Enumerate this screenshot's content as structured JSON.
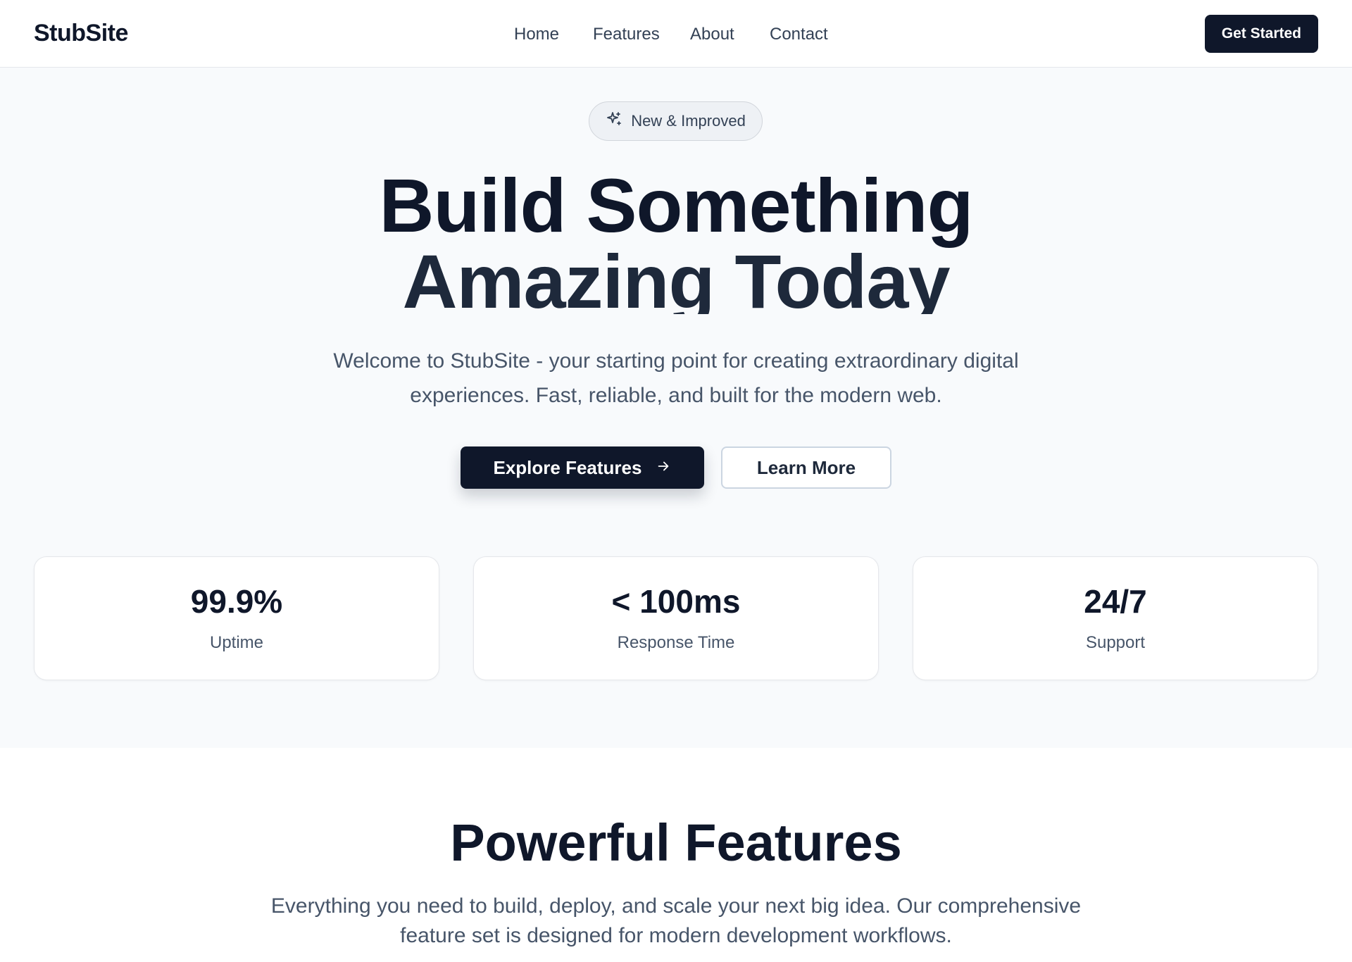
{
  "nav": {
    "brand": "StubSite",
    "links": [
      "Home",
      "Features",
      "About",
      "Contact"
    ],
    "cta": "Get Started"
  },
  "hero": {
    "badge": "New & Improved",
    "headline_line1": "Build Something",
    "headline_line2": "Amazing Today",
    "subtitle": "Welcome to StubSite - your starting point for creating extraordinary digital experiences. Fast, reliable, and built for the modern web.",
    "primary_button": "Explore Features",
    "secondary_button": "Learn More",
    "stats": [
      {
        "value": "99.9%",
        "label": "Uptime"
      },
      {
        "value": "< 100ms",
        "label": "Response Time"
      },
      {
        "value": "24/7",
        "label": "Support"
      }
    ]
  },
  "features": {
    "title": "Powerful Features",
    "subtitle": "Everything you need to build, deploy, and scale your next big idea. Our comprehensive feature set is designed for modern development workflows."
  },
  "colors": {
    "primary": "#0f172a",
    "hero_bg": "#f8fafc",
    "muted_text": "#475569"
  },
  "icons": {
    "badge": "sparkles-icon",
    "primary_button": "arrow-right-icon"
  }
}
